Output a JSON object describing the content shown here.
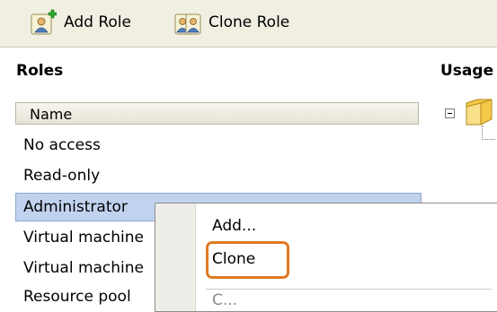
{
  "toolbar": {
    "add_role_label": "Add Role",
    "clone_role_label": "Clone Role",
    "add_role_icon": "add-role-icon",
    "clone_role_icon": "clone-role-icon"
  },
  "roles": {
    "title": "Roles",
    "column_header": "Name",
    "items": [
      "No access",
      "Read-only",
      "Administrator",
      "Virtual machine",
      "Virtual machine",
      "Resource pool"
    ],
    "selected": "Administrator"
  },
  "usage": {
    "title": "Usage",
    "tree_icon": "folder-icon"
  },
  "context_menu": {
    "items": [
      "Add...",
      "Clone",
      "C..."
    ],
    "highlighted": "Clone",
    "highlight_color": "#e07a22"
  },
  "colors": {
    "toolbar_bg": "#f1efe2",
    "selection_bg": "#c1d2ee"
  }
}
